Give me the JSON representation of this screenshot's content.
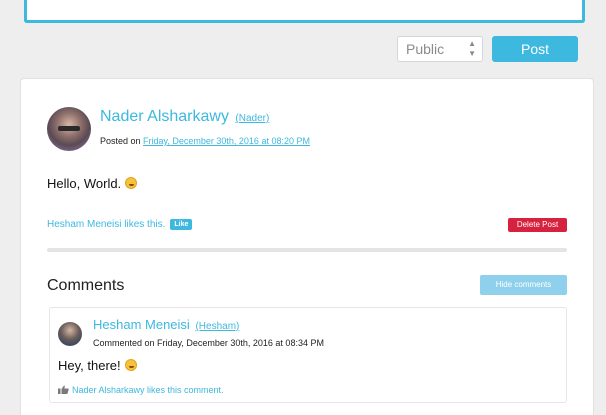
{
  "composer": {
    "visibility": "Public",
    "post_label": "Post"
  },
  "post": {
    "author": "Nader Alsharkawy",
    "handle": "(Nader)",
    "posted_prefix": "Posted on",
    "posted_date": "Friday, December 30th, 2016 at 08:20 PM",
    "body": "Hello, World.",
    "likes_text": "Hesham Meneisi likes this.",
    "like_label": "Like",
    "delete_label": "Delete Post"
  },
  "comments": {
    "title": "Comments",
    "hide_label": "Hide comments",
    "items": [
      {
        "author": "Hesham Meneisi",
        "handle": "(Hesham)",
        "meta": "Commented on Friday, December 30th, 2016 at 08:34 PM",
        "body": "Hey, there!",
        "likes_text": "Nader Alsharkawy likes this comment."
      }
    ]
  },
  "colors": {
    "accent": "#3db8df",
    "danger": "#d6223f",
    "hide_button": "#8fd0ec"
  },
  "icons": [
    "select-arrows-icon",
    "smiley-emoji-icon",
    "tongue-emoji-icon",
    "thumbs-up-icon"
  ]
}
